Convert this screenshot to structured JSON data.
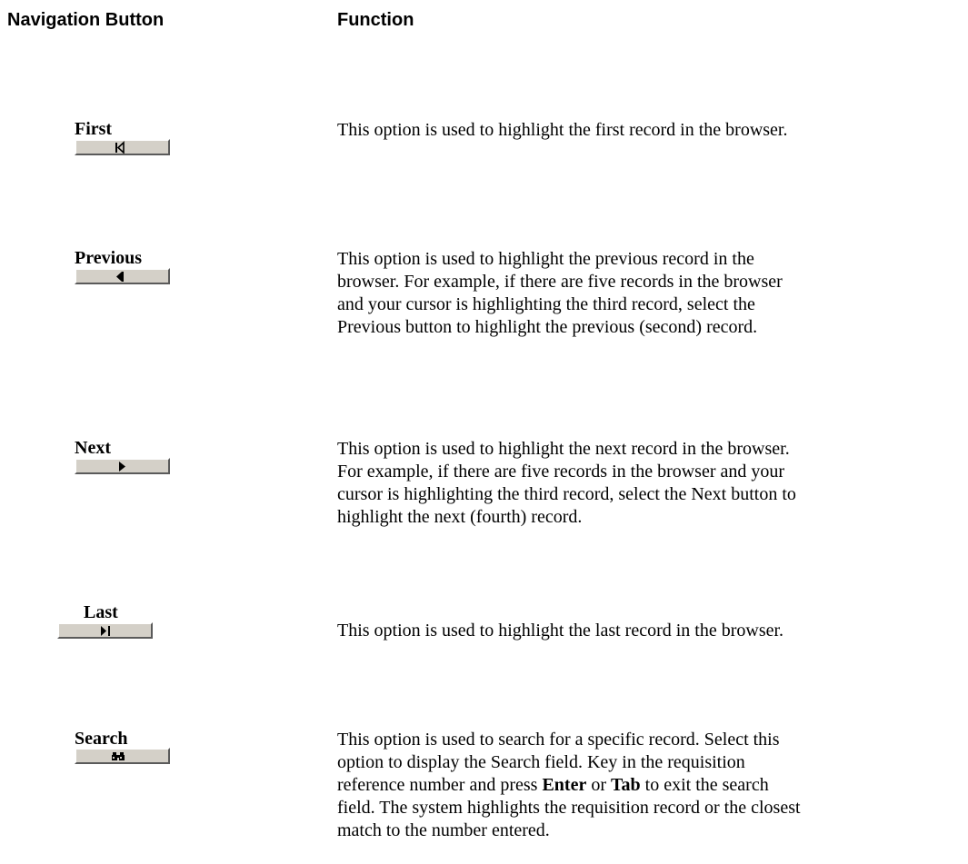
{
  "headers": {
    "navigation_button": "Navigation Button",
    "function": "Function"
  },
  "rows": [
    {
      "label": "First",
      "icon": "first-record-icon",
      "desc_lines": [
        "This option is used to highlight the first record in the browser."
      ]
    },
    {
      "label": "Previous",
      "icon": "previous-record-icon",
      "desc_lines": [
        "This option is used to highlight the previous record in the",
        "browser.  For example, if there are five records in the browser",
        "and your cursor is highlighting the third record, select the",
        "Previous button to highlight the previous (second) record."
      ]
    },
    {
      "label": "Next",
      "icon": "next-record-icon",
      "desc_lines": [
        "This option is used to highlight the next record in the browser.",
        "For example, if there are five records in the browser and your",
        "cursor is highlighting the third record, select the Next button to",
        "highlight the next (fourth) record."
      ]
    },
    {
      "label": "Last",
      "icon": "last-record-icon",
      "desc_lines": [
        "This option is used to highlight the last record in the browser."
      ]
    },
    {
      "label": "Search",
      "icon": "binoculars-icon",
      "desc_line1": "This option is used to search for a specific record.  Select this",
      "desc_line2": "option to display the Search field.  Key in the requisition",
      "desc_line3_a": "reference number and press ",
      "desc_line3_b": "Enter",
      "desc_line3_c": " or ",
      "desc_line3_d": "Tab",
      "desc_line3_e": " to exit the search",
      "desc_line4": "field.  The system highlights the requisition record or the closest",
      "desc_line5": "match to the number entered."
    }
  ]
}
